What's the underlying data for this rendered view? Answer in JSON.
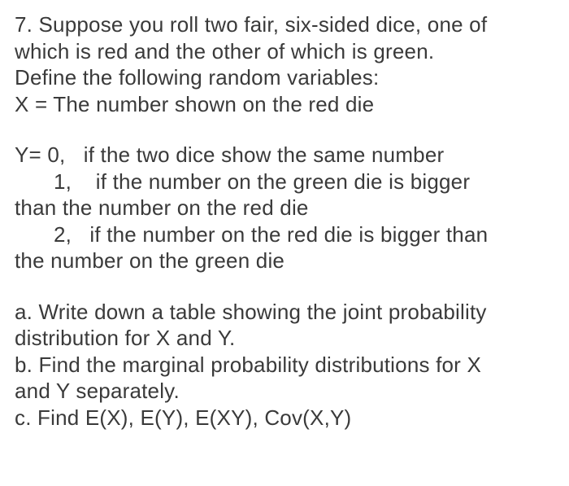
{
  "problem": {
    "number": "7.",
    "intro_l1": "7. Suppose you roll two fair, six-sided dice, one of",
    "intro_l2": "which is red and the other of which is green.",
    "intro_l3": "Define the following random variables:",
    "x_def": "X = The number shown on the red die",
    "y_l1_a": "Y= 0,",
    "y_l1_b": "if the two dice show the same number",
    "y_l2_a": "1,",
    "y_l2_b": "if the number on the green die is bigger",
    "y_l3": "than the number on the red die",
    "y_l4_a": "2,",
    "y_l4_b": "if the number on the red die is bigger than",
    "y_l5": "the number on the green die",
    "part_a_l1": "a. Write down a table showing the joint probability",
    "part_a_l2": "distribution for X and Y.",
    "part_b_l1": "b. Find the marginal probability distributions for X",
    "part_b_l2": "and Y separately.",
    "part_c": "c. Find E(X), E(Y), E(XY), Cov(X,Y)"
  }
}
